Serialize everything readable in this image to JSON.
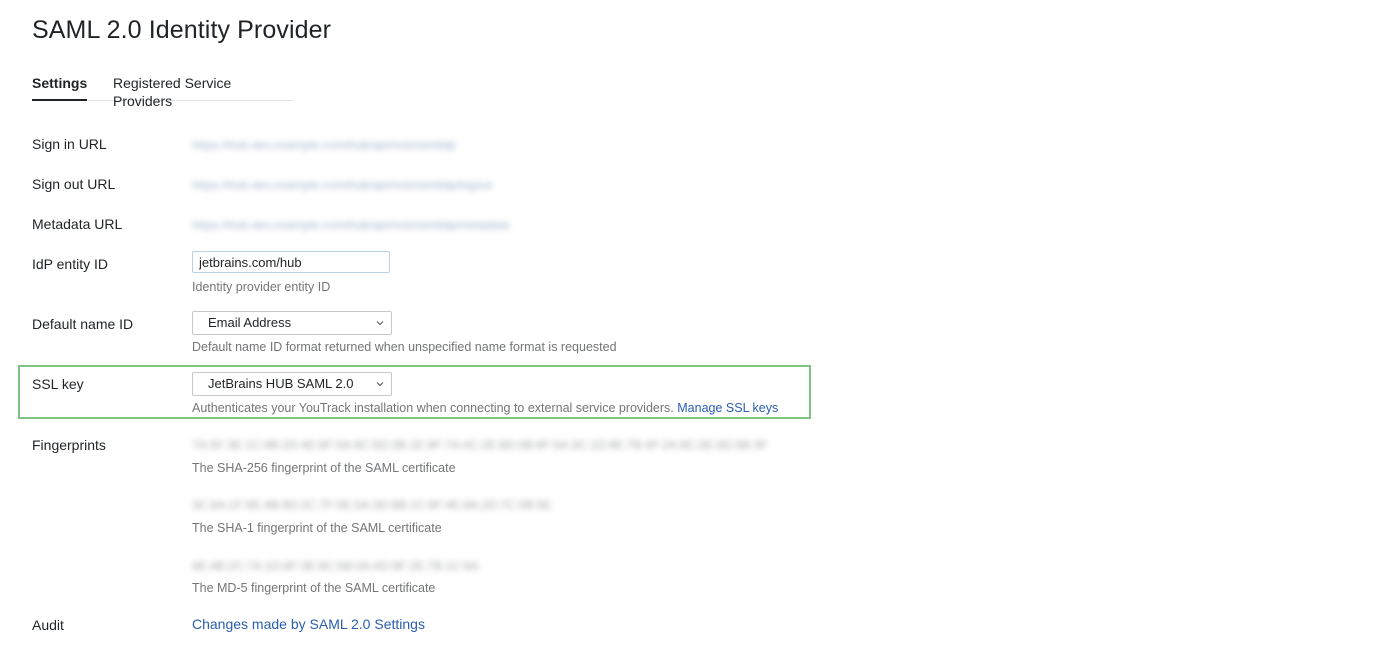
{
  "page": {
    "title": "SAML 2.0 Identity Provider"
  },
  "tabs": [
    {
      "label": "Settings",
      "active": true
    },
    {
      "label": "Registered Service Providers",
      "active": false
    }
  ],
  "fields": {
    "sign_in_url": {
      "label": "Sign in URL",
      "value": "https://hub-dev.example.com/hub/api/rest/samlidp"
    },
    "sign_out_url": {
      "label": "Sign out URL",
      "value": "https://hub-dev.example.com/hub/api/rest/samlidp/logout"
    },
    "metadata_url": {
      "label": "Metadata URL",
      "value": "https://hub-dev.example.com/hub/api/rest/samlidp/metadata"
    },
    "idp_entity_id": {
      "label": "IdP entity ID",
      "value": "jetbrains.com/hub",
      "hint": "Identity provider entity ID"
    },
    "default_name_id": {
      "label": "Default name ID",
      "selected": "Email Address",
      "hint": "Default name ID format returned when unspecified name format is requested"
    },
    "ssl_key": {
      "label": "SSL key",
      "selected": "JetBrains HUB SAML 2.0",
      "hint": "Authenticates your YouTrack installation when connecting to external service providers.",
      "link": "Manage SSL keys"
    },
    "fingerprints": {
      "label": "Fingerprints",
      "sha256": "7A:5F:3E:1C:9B:2D:4E:8F:0A:6C:5D:3B:1E:9F:7A:4C:2E:8D:0B:6F:5A:3C:1D:9E:7B:4F:2A:8C:0E:6D:5B:3F",
      "sha256_hint": "The SHA-256 fingerprint of the SAML certificate",
      "sha1": "3C:8A:1F:6E:4B:9D:2C:7F:0E:5A:3D:8B:1C:6F:4E:9A:2D:7C:0B:5E",
      "sha1_hint": "The SHA-1 fingerprint of the SAML certificate",
      "md5": "9E:4B:2C:7A:1D:6F:3E:8C:5B:0A:4D:9F:2E:7B:1C:6A",
      "md5_hint": "The MD-5 fingerprint of the SAML certificate"
    },
    "audit": {
      "label": "Audit",
      "link": "Changes made by SAML 2.0 Settings"
    }
  },
  "colors": {
    "link": "#2a5db0",
    "highlight_border": "#7cc47f",
    "input_border": "#b8d1e5"
  }
}
